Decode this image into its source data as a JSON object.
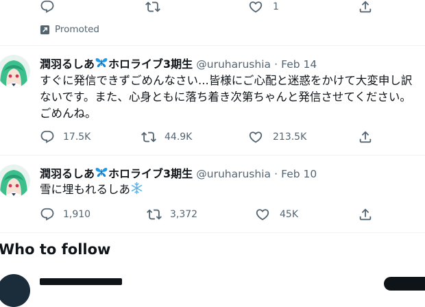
{
  "top_actions": {
    "reply_count": "",
    "retweet_count": "",
    "like_count": "1",
    "share_count": ""
  },
  "promoted_label": "Promoted",
  "tweets": [
    {
      "author_name": "潤羽るしあ",
      "author_suffix": "ホロライブ3期生",
      "handle": "@uruharushia",
      "separator": "·",
      "date": "Feb 14",
      "text_lines": [
        "すぐに発信できずごめんなさい...皆様にご心配と迷惑をかけて大変申し訳",
        "ないです。また、心身ともに落ち着き次第ちゃんと発信させてください。",
        "ごめんね。"
      ],
      "reply_count": "17.5K",
      "retweet_count": "44.9K",
      "like_count": "213.5K"
    },
    {
      "author_name": "潤羽るしあ",
      "author_suffix": "ホロライブ3期生",
      "handle": "@uruharushia",
      "separator": "·",
      "date": "Feb 10",
      "text_lines": [
        "雪に埋もれるしあ"
      ],
      "reply_count": "1,910",
      "retweet_count": "3,372",
      "like_count": "45K"
    }
  ],
  "who_to_follow": {
    "title": "Who to follow"
  },
  "colors": {
    "text": "#0f1419",
    "secondary": "#536471",
    "divider": "#eff3f4",
    "butterfly": "#1d9bf0",
    "avatar_hair": "#3bbf8c"
  },
  "icons": [
    "reply-icon",
    "retweet-icon",
    "like-icon",
    "share-icon",
    "promoted-icon",
    "butterfly-icon",
    "snowflake-icon"
  ]
}
